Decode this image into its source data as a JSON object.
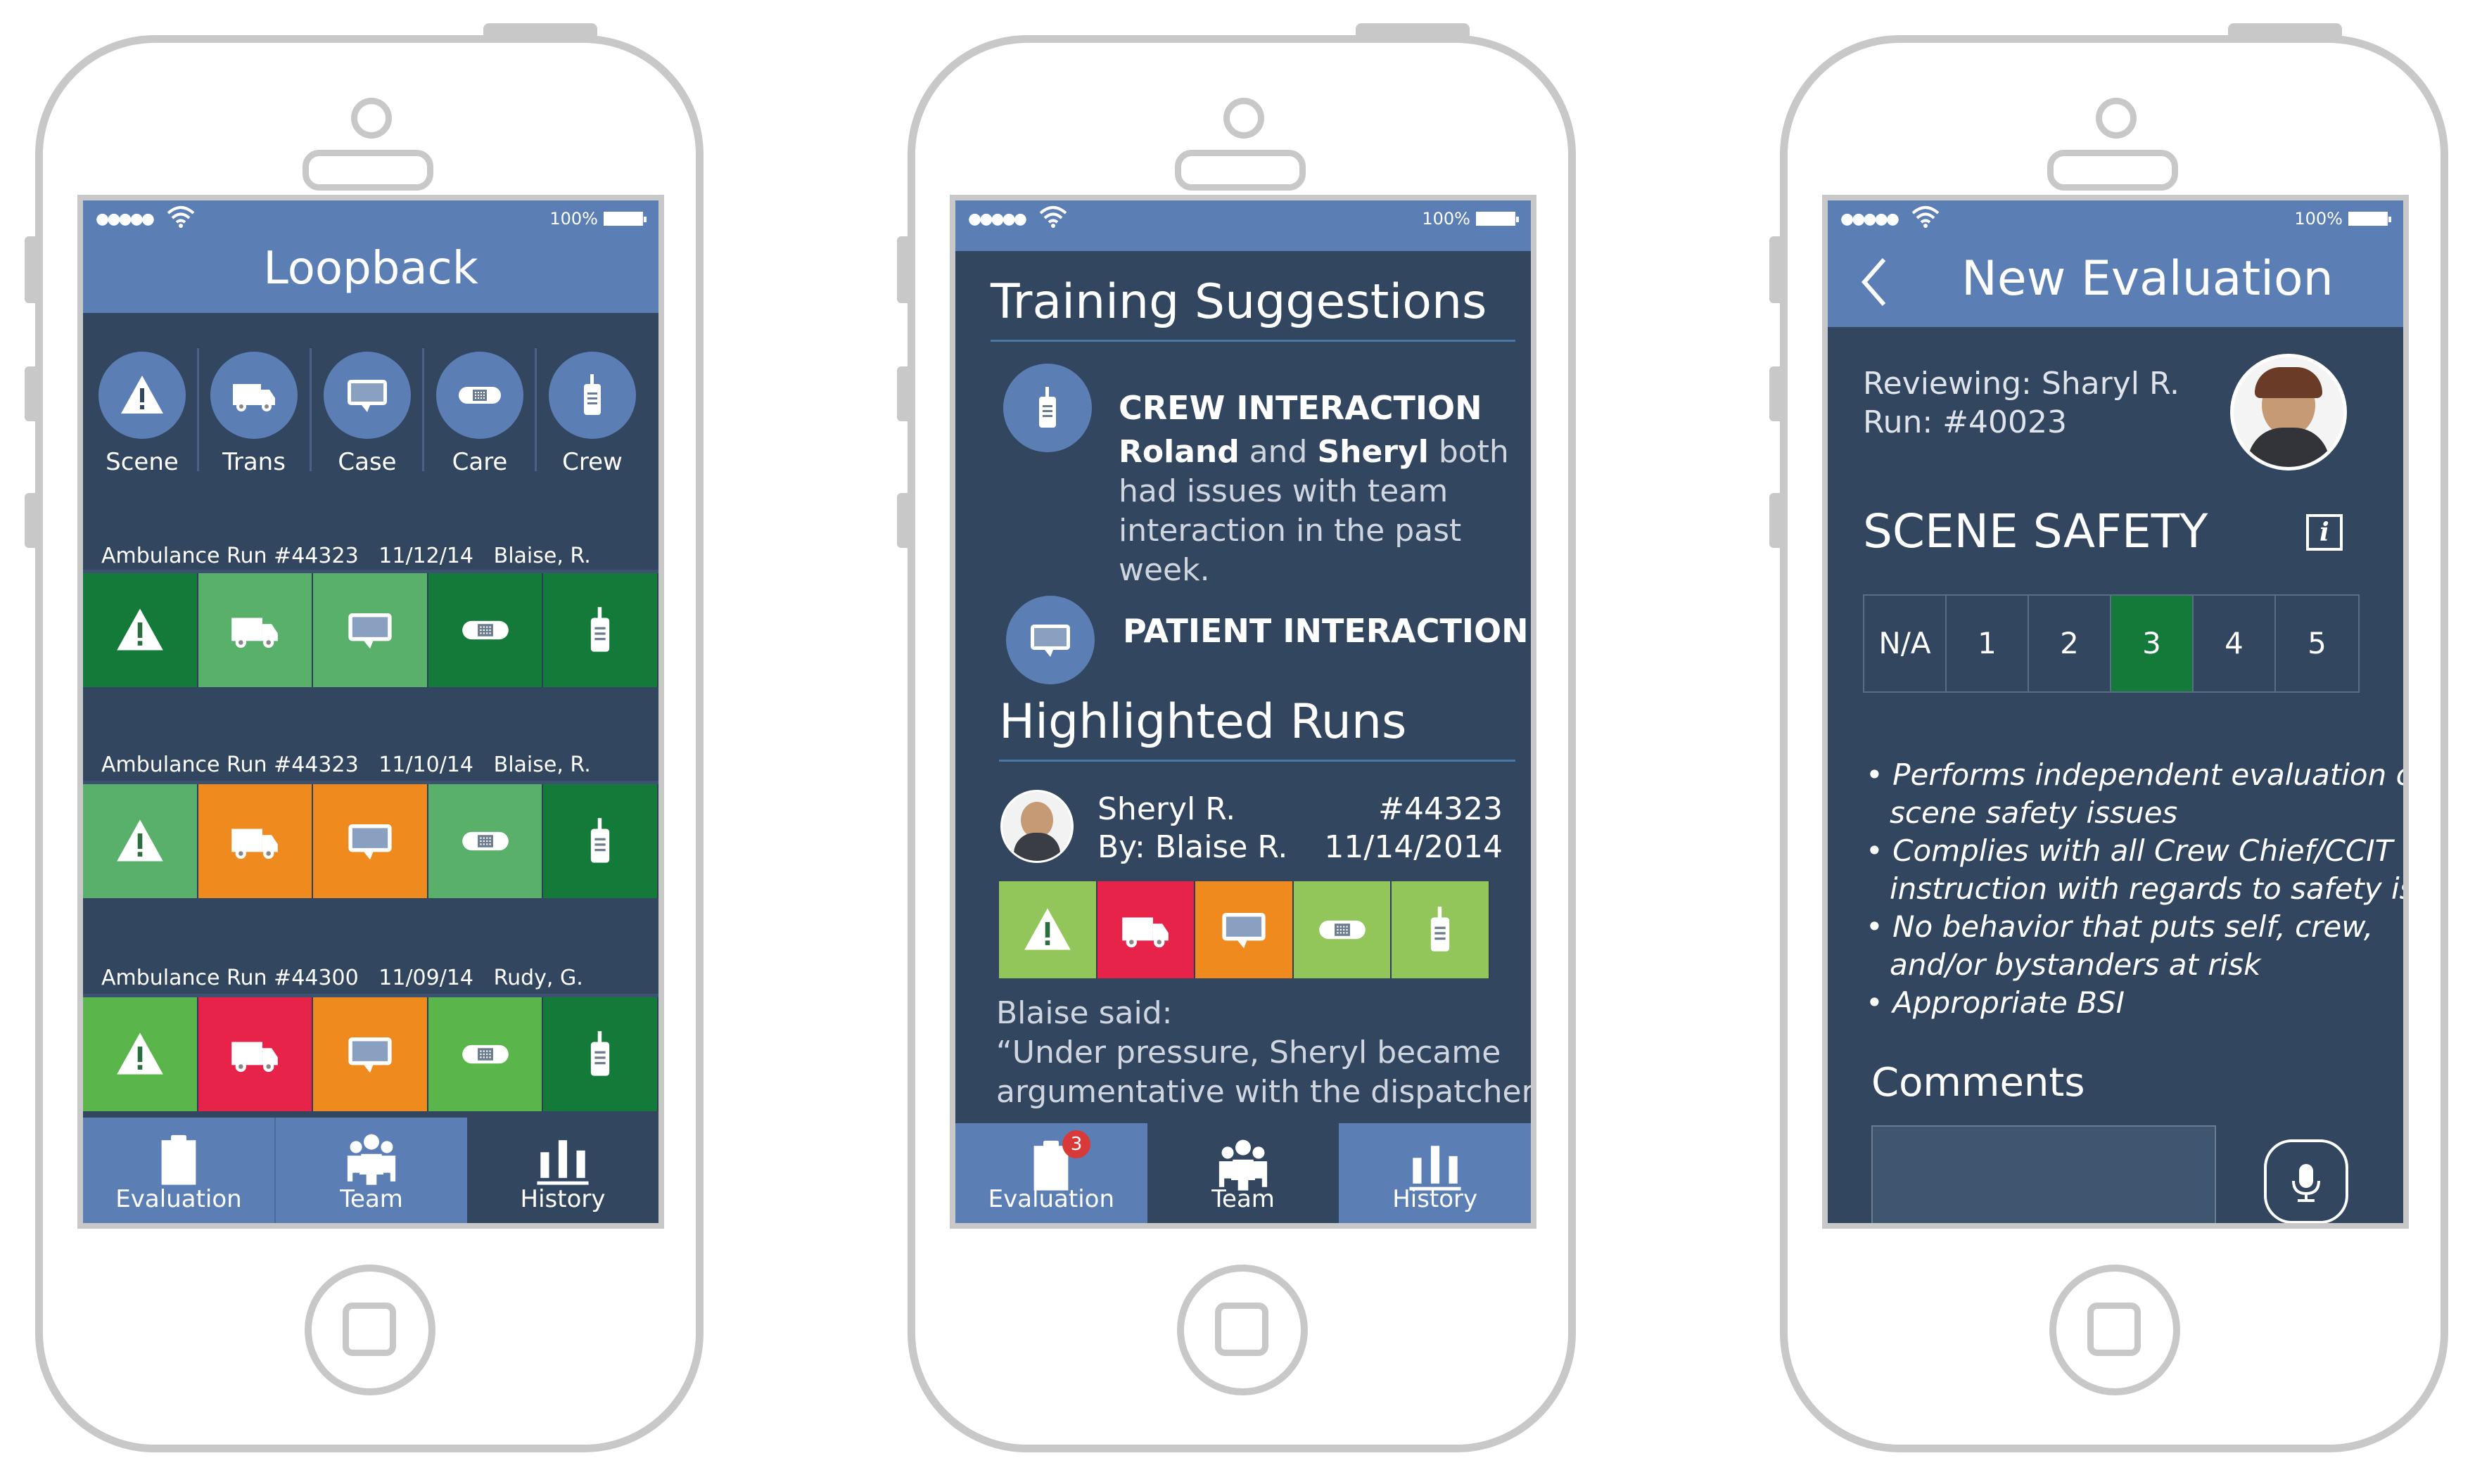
{
  "colors": {
    "header_blue": "#5b7fb5",
    "screen_bg": "#324660",
    "dark_green": "#137a3a",
    "mid_green": "#59b06b",
    "light_green": "#92c65a",
    "bright_green": "#5ab54a",
    "orange": "#ef8a1f",
    "red": "#e8234a",
    "selected_green": "#137a3a",
    "frame_gray": "#c8c8c8"
  },
  "screen1": {
    "status": {
      "battery": "100%"
    },
    "title": "Loopback",
    "categories": [
      {
        "label": "Scene",
        "icon": "warning-icon"
      },
      {
        "label": "Trans",
        "icon": "ambulance-icon"
      },
      {
        "label": "Case",
        "icon": "chat-monitor-icon"
      },
      {
        "label": "Care",
        "icon": "bandage-icon"
      },
      {
        "label": "Crew",
        "icon": "radio-icon"
      }
    ],
    "runs": [
      {
        "title": "Ambulance Run #44323",
        "date": "11/12/14",
        "reviewer": "Blaise, R.",
        "colors": [
          "dark_green",
          "mid_green",
          "mid_green",
          "dark_green",
          "dark_green"
        ]
      },
      {
        "title": "Ambulance Run #44323",
        "date": "11/10/14",
        "reviewer": "Blaise, R.",
        "colors": [
          "mid_green",
          "orange",
          "orange",
          "mid_green",
          "dark_green"
        ]
      },
      {
        "title": "Ambulance Run #44300",
        "date": "11/09/14",
        "reviewer": "Rudy, G.",
        "colors": [
          "bright_green",
          "red",
          "orange",
          "bright_green",
          "dark_green"
        ]
      }
    ],
    "tabs": [
      {
        "label": "Evaluation",
        "icon": "clipboard-icon",
        "active": false
      },
      {
        "label": "Team",
        "icon": "team-icon",
        "active": false
      },
      {
        "label": "History",
        "icon": "bar-chart-icon",
        "active": true
      }
    ]
  },
  "screen2": {
    "status": {
      "battery": "100%"
    },
    "title": "Training Suggestions",
    "suggestions": [
      {
        "title": "CREW INTERACTION",
        "icon": "radio-icon",
        "name1": "Roland",
        "and": "and",
        "name2": "Sheryl",
        "rest_line1": "both",
        "rest_lines": [
          "had issues with team",
          "interaction in the past",
          "week."
        ]
      },
      {
        "title": "PATIENT INTERACTION",
        "icon": "chat-monitor-icon"
      }
    ],
    "highlighted_title": "Highlighted Runs",
    "run": {
      "person": "Sheryl R.",
      "by": "By: Blaise R.",
      "number": "#44323",
      "date": "11/14/2014",
      "colors": [
        "light_green",
        "red",
        "orange",
        "light_green",
        "light_green"
      ]
    },
    "comment_author": "Blaise said:",
    "comment_lines": [
      "“Under pressure, Sheryl became",
      "argumentative with the dispatcher"
    ],
    "tabs": [
      {
        "label": "Evaluation",
        "icon": "clipboard-icon",
        "active": true,
        "badge": "3"
      },
      {
        "label": "Team",
        "icon": "team-icon",
        "active": false
      },
      {
        "label": "History",
        "icon": "bar-chart-icon",
        "active": true
      }
    ]
  },
  "screen3": {
    "status": {
      "battery": "100%"
    },
    "title": "New Evaluation",
    "back_icon": "chevron-left-icon",
    "reviewing": "Reviewing: Sharyl R.",
    "run": "Run: #40023",
    "section": "SCENE SAFETY",
    "info_icon": "info-icon",
    "scale": [
      "N/A",
      "1",
      "2",
      "3",
      "4",
      "5"
    ],
    "selected": "3",
    "criteria_lines": [
      {
        "bullet": true,
        "text": "Performs independent evaluation of"
      },
      {
        "bullet": false,
        "text": "scene safety issues"
      },
      {
        "bullet": true,
        "text": "Complies with all Crew Chief/CCIT"
      },
      {
        "bullet": false,
        "text": "instruction with regards to safety issues"
      },
      {
        "bullet": true,
        "text": "No behavior that puts self, crew,"
      },
      {
        "bullet": false,
        "text": "and/or bystanders at risk"
      },
      {
        "bullet": true,
        "text": "Appropriate BSI"
      }
    ],
    "bullet_char": "•",
    "comments_label": "Comments",
    "mic_icon": "microphone-icon"
  }
}
